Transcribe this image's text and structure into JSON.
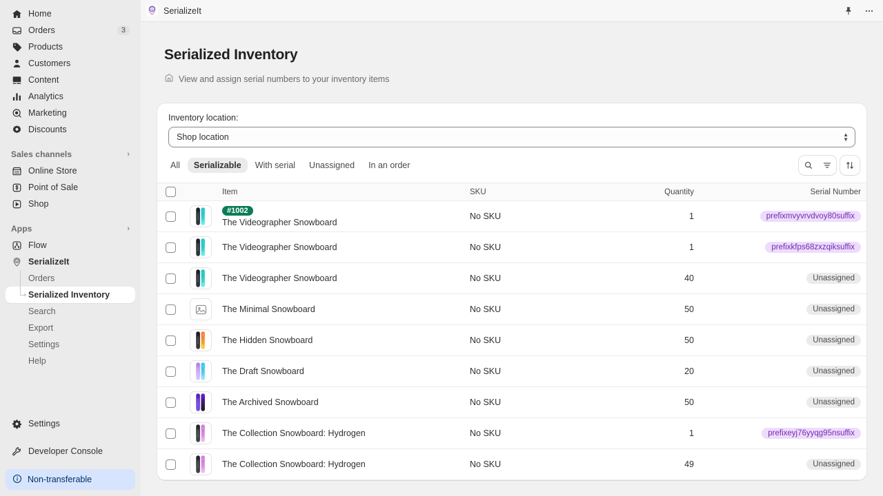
{
  "topbar": {
    "app_title": "SerializeIt",
    "logo_letter": "S",
    "pin_icon": "pin-icon",
    "more_icon": "ellipsis-icon"
  },
  "sidebar": {
    "primary": [
      {
        "label": "Home",
        "icon": "home-icon",
        "badge": ""
      },
      {
        "label": "Orders",
        "icon": "orders-icon",
        "badge": "3"
      },
      {
        "label": "Products",
        "icon": "products-icon",
        "badge": ""
      },
      {
        "label": "Customers",
        "icon": "customers-icon",
        "badge": ""
      },
      {
        "label": "Content",
        "icon": "content-icon",
        "badge": ""
      },
      {
        "label": "Analytics",
        "icon": "analytics-icon",
        "badge": ""
      },
      {
        "label": "Marketing",
        "icon": "marketing-icon",
        "badge": ""
      },
      {
        "label": "Discounts",
        "icon": "discounts-icon",
        "badge": ""
      }
    ],
    "sales_channels_header": "Sales channels",
    "sales_channels": [
      {
        "label": "Online Store",
        "icon": "store-icon"
      },
      {
        "label": "Point of Sale",
        "icon": "pos-icon"
      },
      {
        "label": "Shop",
        "icon": "shop-icon"
      }
    ],
    "apps_header": "Apps",
    "apps": [
      {
        "label": "Flow",
        "icon": "flow-icon"
      },
      {
        "label": "SerializeIt",
        "icon": "serializeit-icon"
      }
    ],
    "app_subitems": [
      {
        "label": "Orders",
        "active": false
      },
      {
        "label": "Serialized Inventory",
        "active": true
      },
      {
        "label": "Search",
        "active": false
      },
      {
        "label": "Export",
        "active": false
      },
      {
        "label": "Settings",
        "active": false
      },
      {
        "label": "Help",
        "active": false
      }
    ],
    "footer": [
      {
        "label": "Settings",
        "icon": "gear-icon"
      },
      {
        "label": "Developer Console",
        "icon": "wrench-icon"
      }
    ],
    "bottom_pill": {
      "label": "Non-transferable",
      "icon": "info-icon"
    }
  },
  "page": {
    "title": "Serialized Inventory",
    "subtitle": "View and assign serial numbers to your inventory items",
    "subtitle_icon": "store-icon"
  },
  "location": {
    "label": "Inventory location:",
    "selected": "Shop location"
  },
  "tabs": [
    {
      "label": "All",
      "active": false
    },
    {
      "label": "Serializable",
      "active": true
    },
    {
      "label": "With serial",
      "active": false
    },
    {
      "label": "Unassigned",
      "active": false
    },
    {
      "label": "In an order",
      "active": false
    }
  ],
  "tab_actions": [
    {
      "name": "search-icon"
    },
    {
      "name": "filter-icon"
    },
    {
      "name": "sort-icon"
    }
  ],
  "table": {
    "columns": [
      "Item",
      "SKU",
      "Quantity",
      "Serial Number"
    ],
    "rows": [
      {
        "order_badge": "#1002",
        "item": "The Videographer Snowboard",
        "sku": "No SKU",
        "quantity": "1",
        "serial": "prefixmvyvrvdvoy80suffix",
        "serial_assigned": true,
        "thumb": "snowboard-teal"
      },
      {
        "order_badge": "",
        "item": "The Videographer Snowboard",
        "sku": "No SKU",
        "quantity": "1",
        "serial": "prefixkfps68zxzqiksuffix",
        "serial_assigned": true,
        "thumb": "snowboard-teal"
      },
      {
        "order_badge": "",
        "item": "The Videographer Snowboard",
        "sku": "No SKU",
        "quantity": "40",
        "serial": "Unassigned",
        "serial_assigned": false,
        "thumb": "snowboard-teal"
      },
      {
        "order_badge": "",
        "item": "The Minimal Snowboard",
        "sku": "No SKU",
        "quantity": "50",
        "serial": "Unassigned",
        "serial_assigned": false,
        "thumb": "placeholder-image"
      },
      {
        "order_badge": "",
        "item": "The Hidden Snowboard",
        "sku": "No SKU",
        "quantity": "50",
        "serial": "Unassigned",
        "serial_assigned": false,
        "thumb": "snowboard-sunset"
      },
      {
        "order_badge": "",
        "item": "The Draft Snowboard",
        "sku": "No SKU",
        "quantity": "20",
        "serial": "Unassigned",
        "serial_assigned": false,
        "thumb": "snowboard-cyan"
      },
      {
        "order_badge": "",
        "item": "The Archived Snowboard",
        "sku": "No SKU",
        "quantity": "50",
        "serial": "Unassigned",
        "serial_assigned": false,
        "thumb": "snowboard-violet"
      },
      {
        "order_badge": "",
        "item": "The Collection Snowboard: Hydrogen",
        "sku": "No SKU",
        "quantity": "1",
        "serial": "prefixeyj76yyqg95nsuffix",
        "serial_assigned": true,
        "thumb": "snowboard-pink"
      },
      {
        "order_badge": "",
        "item": "The Collection Snowboard: Hydrogen",
        "sku": "No SKU",
        "quantity": "49",
        "serial": "Unassigned",
        "serial_assigned": false,
        "thumb": "snowboard-pink"
      }
    ]
  },
  "colors": {
    "order_badge": "#0a7d55",
    "serial_pill_bg": "#eddcfd",
    "serial_pill_text": "#7429ad",
    "unassigned_bg": "#ebebeb",
    "pill_info_bg": "#d6e4fd",
    "pill_info_text": "#00316b"
  }
}
